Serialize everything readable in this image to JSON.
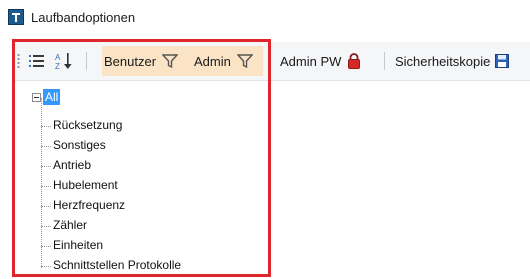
{
  "window": {
    "title": "Laufbandoptionen",
    "app_icon": "treadmill-app-icon"
  },
  "toolbar": {
    "categorized_icon": "categorized-list-icon",
    "sort_icon": "sort-alphabetical-icon",
    "buttons": [
      {
        "label": "Benutzer",
        "icon": "filter-funnel-icon"
      },
      {
        "label": "Admin",
        "icon": "filter-funnel-icon"
      },
      {
        "label": "Admin PW",
        "icon": "red-lock-icon"
      },
      {
        "label": "Sicherheitskopie",
        "icon": "save-floppy-icon"
      }
    ],
    "highlight_color": "#fbe4c6"
  },
  "tree": {
    "root": {
      "label": "All",
      "expanded": true,
      "selected": true
    },
    "items": [
      {
        "label": "Rücksetzung"
      },
      {
        "label": "Sonstiges"
      },
      {
        "label": "Antrieb"
      },
      {
        "label": "Hubelement"
      },
      {
        "label": "Herzfrequenz"
      },
      {
        "label": "Zähler"
      },
      {
        "label": "Einheiten"
      },
      {
        "label": "Schnittstellen Protokolle"
      }
    ]
  },
  "annotation": {
    "color": "#e0262d"
  }
}
